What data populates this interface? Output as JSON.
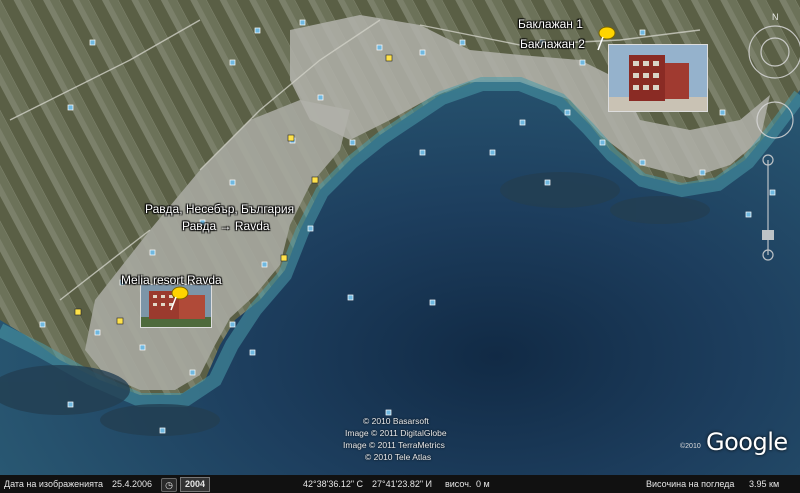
{
  "map": {
    "place_labels": {
      "ravda_full": "Равда, Несебър, България",
      "ravda": "Равда → Ravda",
      "melia": "Melia resort Ravda",
      "baklazhan1": "Баклажан 1",
      "baklazhan2": "Баклажан 2"
    },
    "copyrights": [
      "© 2010 Basarsoft",
      "Image © 2011 DigitalGlobe",
      "Image © 2011 TerraMetrics",
      "© 2010 Tele Atlas"
    ],
    "logo": {
      "year": "©2010",
      "text": "Google"
    },
    "colors": {
      "sea_deep": "#1d3e5e",
      "sea_shallow": "#3f8fa0",
      "land": "#6f7a63",
      "town": "#b9b9b2",
      "pin": "#ffd400"
    }
  },
  "statusbar": {
    "date_label": "Дата на изображенията",
    "date_value": "25.4.2006",
    "year_badge": "2004",
    "coordinates": "42°38'36.12\" С",
    "longitude": "27°41'23.82\" И",
    "altitude_label": "височ.",
    "altitude_value": "0 м",
    "eye_label": "Височина на погледа",
    "eye_value": "3.95 км"
  }
}
